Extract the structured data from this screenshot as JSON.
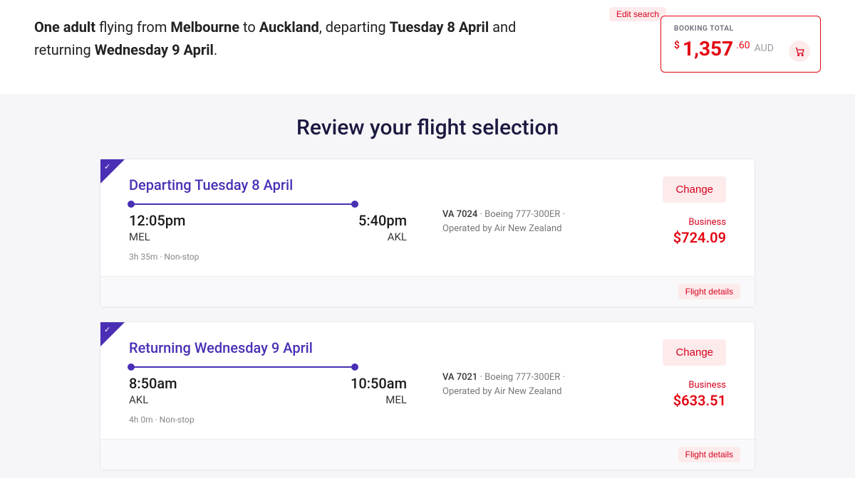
{
  "header": {
    "passengers_label": "One adult",
    "mid_text_1": " flying from ",
    "from_city": "Melbourne",
    "to_word": " to ",
    "to_city": "Auckland",
    "mid_text_2": ", departing ",
    "depart_date": "Tuesday 8 April",
    "mid_text_3": " and returning ",
    "return_date": "Wednesday 9 April",
    "period": ".",
    "edit_search": "Edit search"
  },
  "booking": {
    "label": "BOOKING TOTAL",
    "dollar": "$",
    "amount_main": "1,357",
    "amount_cents": ".60",
    "currency": "AUD"
  },
  "page_title": "Review your flight selection",
  "flights": [
    {
      "title": "Departing Tuesday 8 April",
      "dep_time": "12:05pm",
      "dep_code": "MEL",
      "arr_time": "5:40pm",
      "arr_code": "AKL",
      "duration": "3h 35m ·  Non-stop",
      "flight_no": "VA 7024",
      "equip_op": " · Boeing 777-300ER · Operated by Air New Zealand",
      "fare_class": "Business",
      "price": "$724.09",
      "change_label": "Change",
      "details_label": "Flight details"
    },
    {
      "title": "Returning Wednesday 9 April",
      "dep_time": "8:50am",
      "dep_code": "AKL",
      "arr_time": "10:50am",
      "arr_code": "MEL",
      "duration": "4h 0m ·  Non-stop",
      "flight_no": "VA 7021",
      "equip_op": " · Boeing 777-300ER · Operated by Air New Zealand",
      "fare_class": "Business",
      "price": "$633.51",
      "change_label": "Change",
      "details_label": "Flight details"
    }
  ]
}
